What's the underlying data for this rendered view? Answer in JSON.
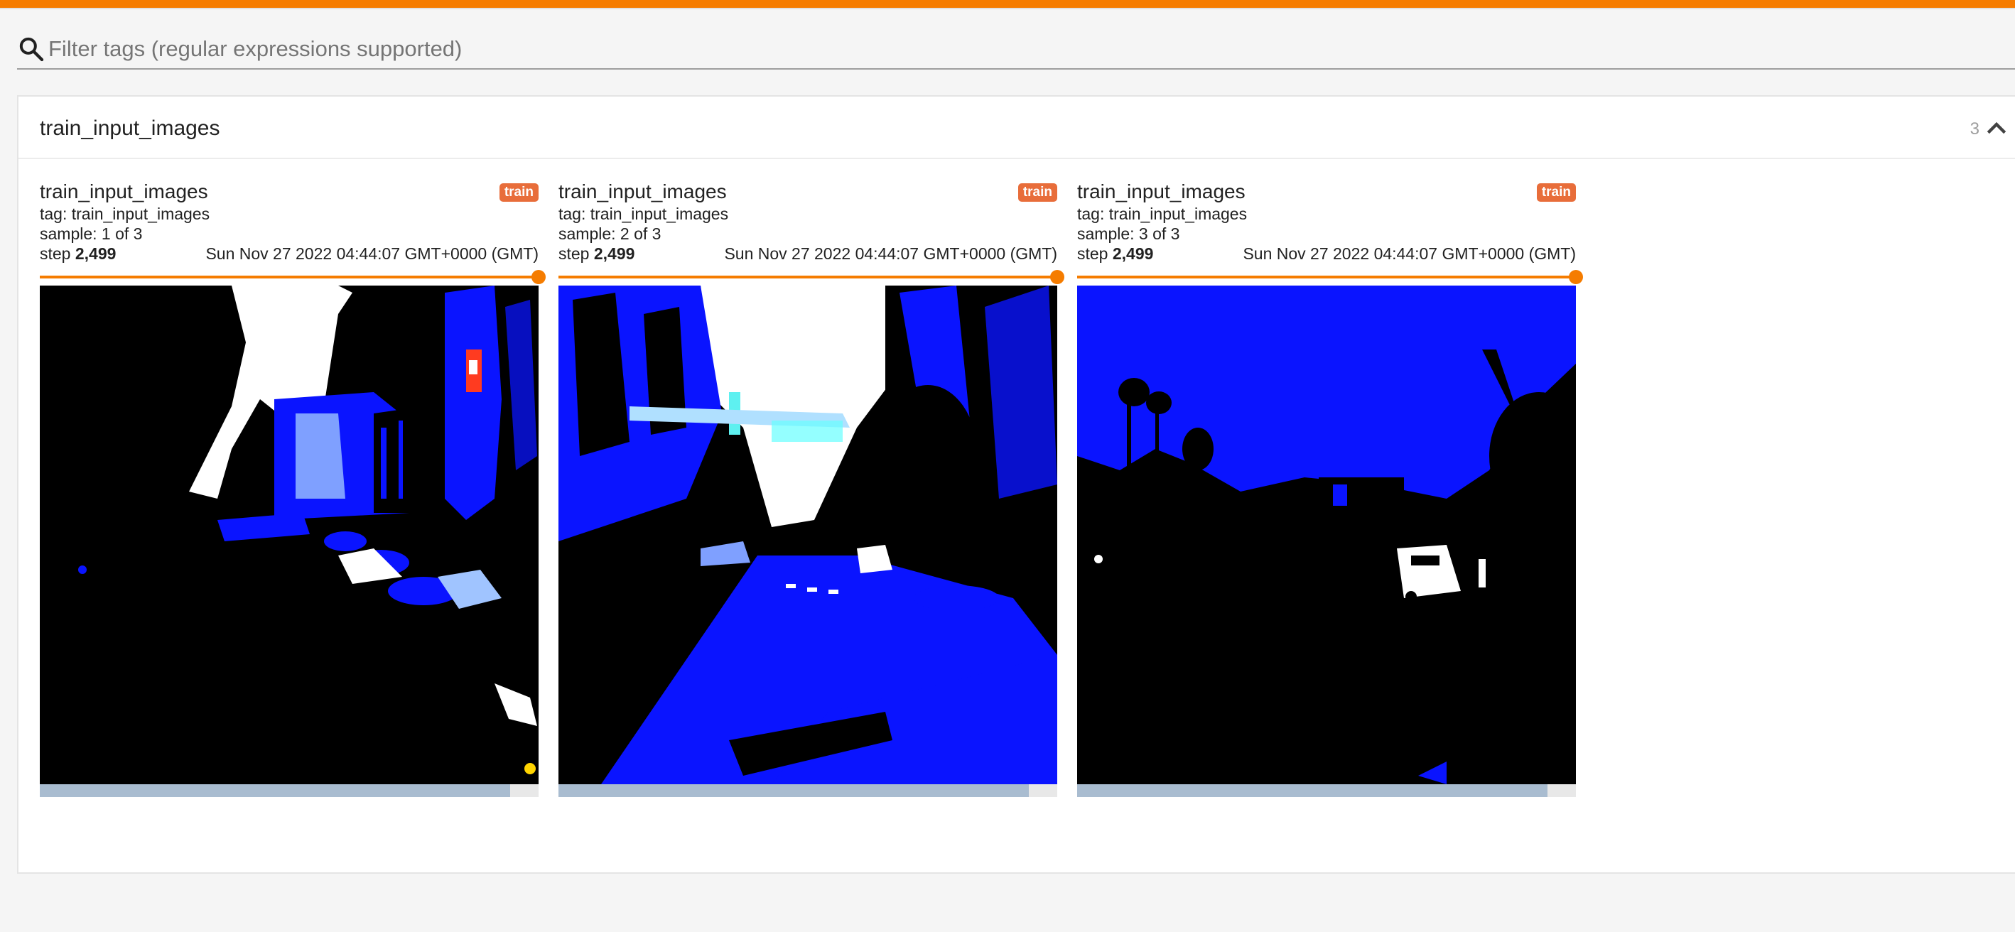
{
  "filter": {
    "placeholder": "Filter tags (regular expressions supported)"
  },
  "card": {
    "title": "train_input_images",
    "count": "3"
  },
  "panels": [
    {
      "title": "train_input_images",
      "run": "train",
      "tag_line": "tag: train_input_images",
      "sample_line": "sample: 1 of 3",
      "step_label": "step",
      "step_value": "2,499",
      "timestamp": "Sun Nov 27 2022 04:44:07 GMT+0000 (GMT)",
      "slider_position": 1.0
    },
    {
      "title": "train_input_images",
      "run": "train",
      "tag_line": "tag: train_input_images",
      "sample_line": "sample: 2 of 3",
      "step_label": "step",
      "step_value": "2,499",
      "timestamp": "Sun Nov 27 2022 04:44:07 GMT+0000 (GMT)",
      "slider_position": 1.0
    },
    {
      "title": "train_input_images",
      "run": "train",
      "tag_line": "tag: train_input_images",
      "sample_line": "sample: 3 of 3",
      "step_label": "step",
      "step_value": "2,499",
      "timestamp": "Sun Nov 27 2022 04:44:07 GMT+0000 (GMT)",
      "slider_position": 1.0
    }
  ],
  "colors": {
    "accent": "#f57c00",
    "run_badge": "#e86d3a",
    "image_blue": "#0a14ff"
  },
  "icons": {
    "search": "search-icon",
    "collapse": "chevron-up-icon"
  }
}
